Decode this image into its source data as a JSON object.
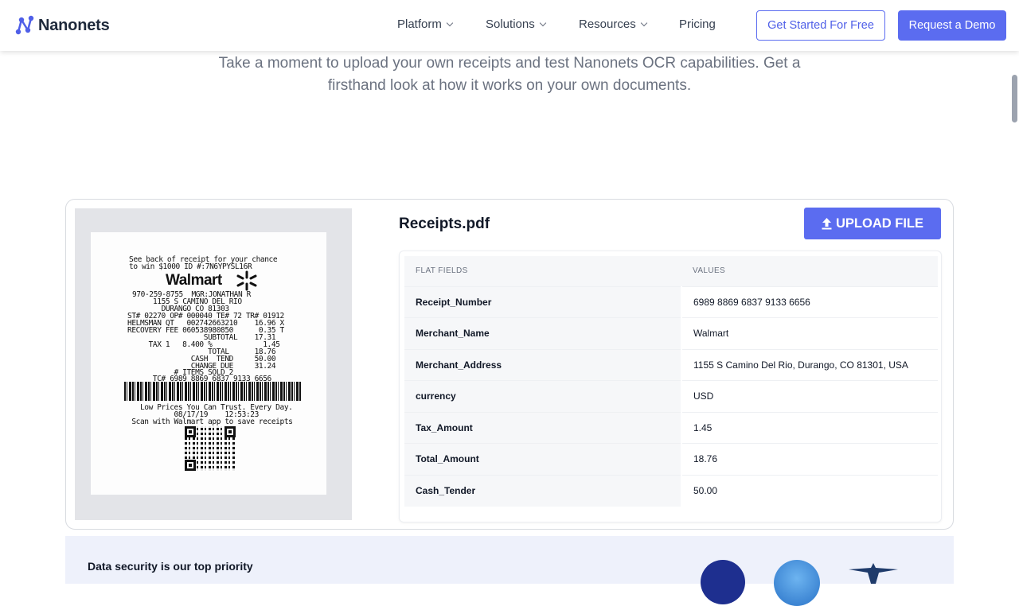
{
  "header": {
    "logo_text": "Nanonets",
    "nav": [
      {
        "label": "Platform"
      },
      {
        "label": "Solutions"
      },
      {
        "label": "Resources"
      },
      {
        "label": "Pricing"
      }
    ],
    "cta_outline": "Get Started For Free",
    "cta_solid": "Request a Demo"
  },
  "intro": {
    "text": "Take a moment to upload your own receipts and test Nanonets OCR capabilities. Get a firsthand look at how it works on your own documents."
  },
  "demo": {
    "file_name": "Receipts.pdf",
    "upload_label": "UPLOAD FILE",
    "table": {
      "col_field": "FLAT FIELDS",
      "col_value": "VALUES",
      "rows": [
        {
          "field": "Receipt_Number",
          "value": "6989 8869 6837 9133 6656"
        },
        {
          "field": "Merchant_Name",
          "value": "Walmart"
        },
        {
          "field": "Merchant_Address",
          "value": "1155 S Camino Del Rio, Durango, CO 81301, USA"
        },
        {
          "field": "currency",
          "value": "USD"
        },
        {
          "field": "Tax_Amount",
          "value": "1.45"
        },
        {
          "field": "Total_Amount",
          "value": "18.76"
        },
        {
          "field": "Cash_Tender",
          "value": "50.00"
        }
      ]
    },
    "receipt": {
      "brand": "Walmart",
      "lines": [
        "See back of receipt for your chance",
        "to win $1000 ID #:7N6YPYSL16R",
        "970-259-8755  MGR:JONATHAN R",
        "   1155 S CAMINO DEL RIO",
        "     DURANGO CO 81303",
        "ST# 02270 OP# 000040 TE# 72 TR# 01912",
        "HELMSMAN QT   002742663210    16.96 X",
        "RECOVERY FEE 060538980850      0.35 T",
        "                  SUBTOTAL    17.31",
        "     TAX 1   8.400 %            1.45",
        "                   TOTAL      18.76",
        "               CASH  TEND     50.00",
        "               CHANGE DUE     31.24",
        "           # ITEMS SOLD 2",
        "      TC# 6989 8869 6837 9133 6656",
        "   Low Prices You Can Trust. Every Day.",
        "           08/17/19    12:53:23",
        " Scan with Walmart app to save receipts"
      ]
    }
  },
  "security": {
    "title": "Data security is our top priority"
  },
  "colors": {
    "accent": "#5b6cf0",
    "text": "#1f2937",
    "muted": "#6b7280"
  }
}
